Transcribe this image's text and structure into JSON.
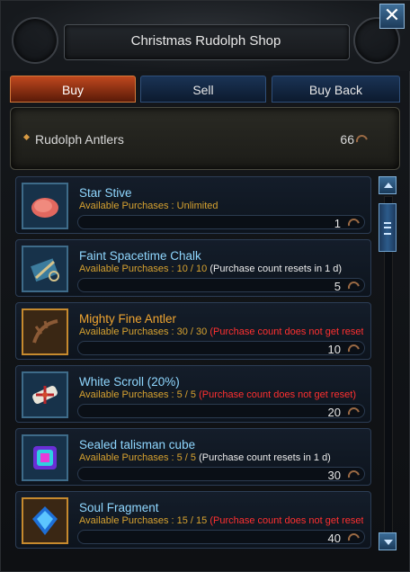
{
  "window": {
    "title": "Christmas Rudolph Shop",
    "close_icon": "close-icon"
  },
  "tabs": [
    {
      "label": "Buy",
      "active": true
    },
    {
      "label": "Sell",
      "active": false
    },
    {
      "label": "Buy Back",
      "active": false
    }
  ],
  "currency": {
    "name": "Rudolph Antlers",
    "count": "66",
    "icon": "antler-icon"
  },
  "items": [
    {
      "name": "Star Stive",
      "avail_label": "Available Purchases : Unlimited",
      "note": "",
      "note_color": "white",
      "price": "1",
      "icon": "star-stive-icon",
      "rarity": "blue"
    },
    {
      "name": "Faint Spacetime Chalk",
      "avail_label": "Available Purchases : 10 / 10",
      "note": "(Purchase count resets in 1 d)",
      "note_color": "white",
      "price": "5",
      "icon": "chalk-icon",
      "rarity": "blue"
    },
    {
      "name": "Mighty Fine Antler",
      "avail_label": "Available Purchases : 30 / 30",
      "note": "(Purchase count does not get reset)",
      "note_color": "red",
      "price": "10",
      "icon": "antler-item-icon",
      "rarity": "gold"
    },
    {
      "name": "White Scroll (20%)",
      "avail_label": "Available Purchases : 5 / 5",
      "note": "(Purchase count does not get reset)",
      "note_color": "red",
      "price": "20",
      "icon": "scroll-icon",
      "rarity": "blue"
    },
    {
      "name": "Sealed talisman cube",
      "avail_label": "Available Purchases : 5 / 5",
      "note": "(Purchase count resets in 1 d)",
      "note_color": "white",
      "price": "30",
      "icon": "talisman-cube-icon",
      "rarity": "blue"
    },
    {
      "name": "Soul Fragment",
      "avail_label": "Available Purchases : 15 / 15",
      "note": "(Purchase count does not get reset)",
      "note_color": "red",
      "price": "40",
      "icon": "soul-fragment-icon",
      "rarity": "gold"
    }
  ],
  "colors": {
    "accent_blue": "#8fd7ff",
    "gold": "#f0a530",
    "warning_red": "#ff3030",
    "avail_orange": "#d7a230"
  }
}
